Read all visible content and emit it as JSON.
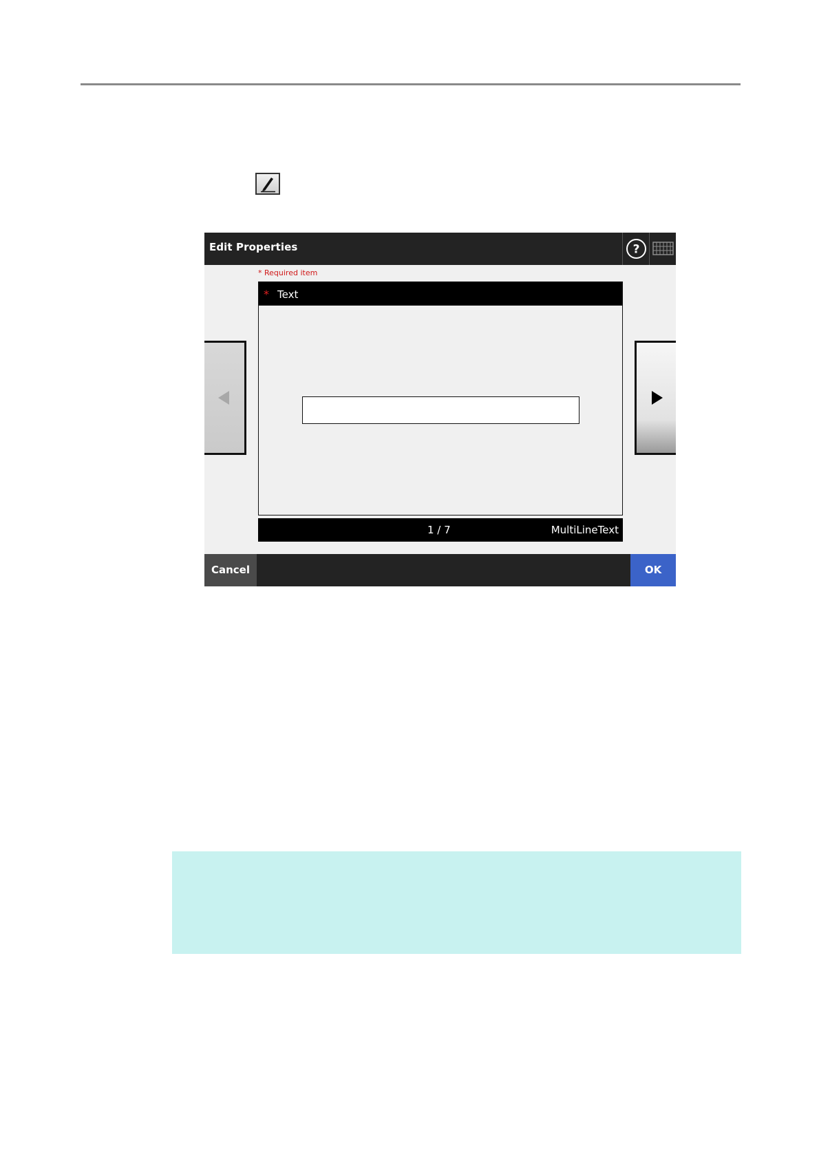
{
  "dialog": {
    "title": "Edit Properties",
    "required_note": "* Required item",
    "field": {
      "required_marker": "*",
      "label": "Text",
      "input_value": ""
    },
    "status": {
      "page_indicator": "1 / 7",
      "field_type": "MultiLineText"
    },
    "footer": {
      "cancel_label": "Cancel",
      "ok_label": "OK"
    }
  },
  "icons": {
    "edit": "pencil-icon",
    "help": "help-icon",
    "keyboard": "keyboard-icon",
    "prev": "left-arrow-icon",
    "next": "right-arrow-icon"
  },
  "colors": {
    "title_bar": "#232323",
    "ok_button": "#3b63c8",
    "required": "#d01818",
    "note_box": "#c8f2f0"
  }
}
